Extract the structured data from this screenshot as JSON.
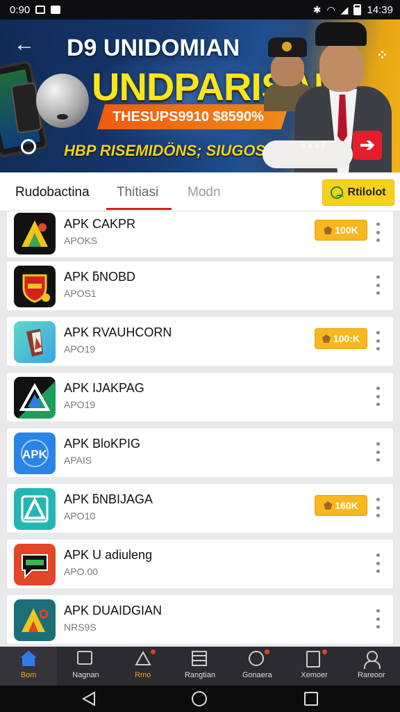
{
  "status_bar": {
    "time": "0:90",
    "clock": "14:39"
  },
  "banner": {
    "subtitle": "D9 UNIDOMIAN",
    "title": "UNDPARISAN",
    "promo": "THESUPS9910 $8590%",
    "tagline": "HBP RISEMIDÖNS; SIUGOSB",
    "small_text": "ꝺ ꝺ ꝺ Ꝩ",
    "accent": "#f7e51d"
  },
  "tabs": {
    "items": [
      {
        "label": "Rudobactina"
      },
      {
        "label": "Thitiasi"
      },
      {
        "label": "Modn"
      }
    ],
    "active_index": 1,
    "follow_button": "Rtilolot"
  },
  "apps": [
    {
      "name": "APK CAKPR",
      "sub": "APOKS",
      "badge": "100K",
      "icon": "a-logo-icon"
    },
    {
      "name": "APK ƃNOBD",
      "sub": "APOS1",
      "badge": "",
      "icon": "shield-logo-icon"
    },
    {
      "name": "APK RVAUHCORN",
      "sub": "APO19",
      "badge": "100:K",
      "icon": "puzzle-logo-icon"
    },
    {
      "name": "APK IJAKPAG",
      "sub": "APO19",
      "badge": "",
      "icon": "app-store-logo-icon"
    },
    {
      "name": "APK BloKPIG",
      "sub": "APAIS",
      "badge": "",
      "icon": "apk-logo-icon"
    },
    {
      "name": "APK ƃNBIJAGA",
      "sub": "APO10",
      "badge": "160K",
      "icon": "a-teal-logo-icon"
    },
    {
      "name": "APK U adiuleng",
      "sub": "APO.00",
      "badge": "",
      "icon": "chat-logo-icon"
    },
    {
      "name": "APK DUAIDGIAN",
      "sub": "NRS9S",
      "badge": "",
      "icon": "a-color-logo-icon"
    }
  ],
  "bottom_nav": [
    {
      "label": "Bom",
      "icon": "home-icon"
    },
    {
      "label": "Nagnan",
      "icon": "inbox-icon"
    },
    {
      "label": "Rmo",
      "icon": "triangle-icon"
    },
    {
      "label": "Rangtian",
      "icon": "grid-icon"
    },
    {
      "label": "Gonaera",
      "icon": "circle-icon"
    },
    {
      "label": "Xemoer",
      "icon": "document-icon"
    },
    {
      "label": "Rareoor",
      "icon": "user-icon"
    }
  ]
}
